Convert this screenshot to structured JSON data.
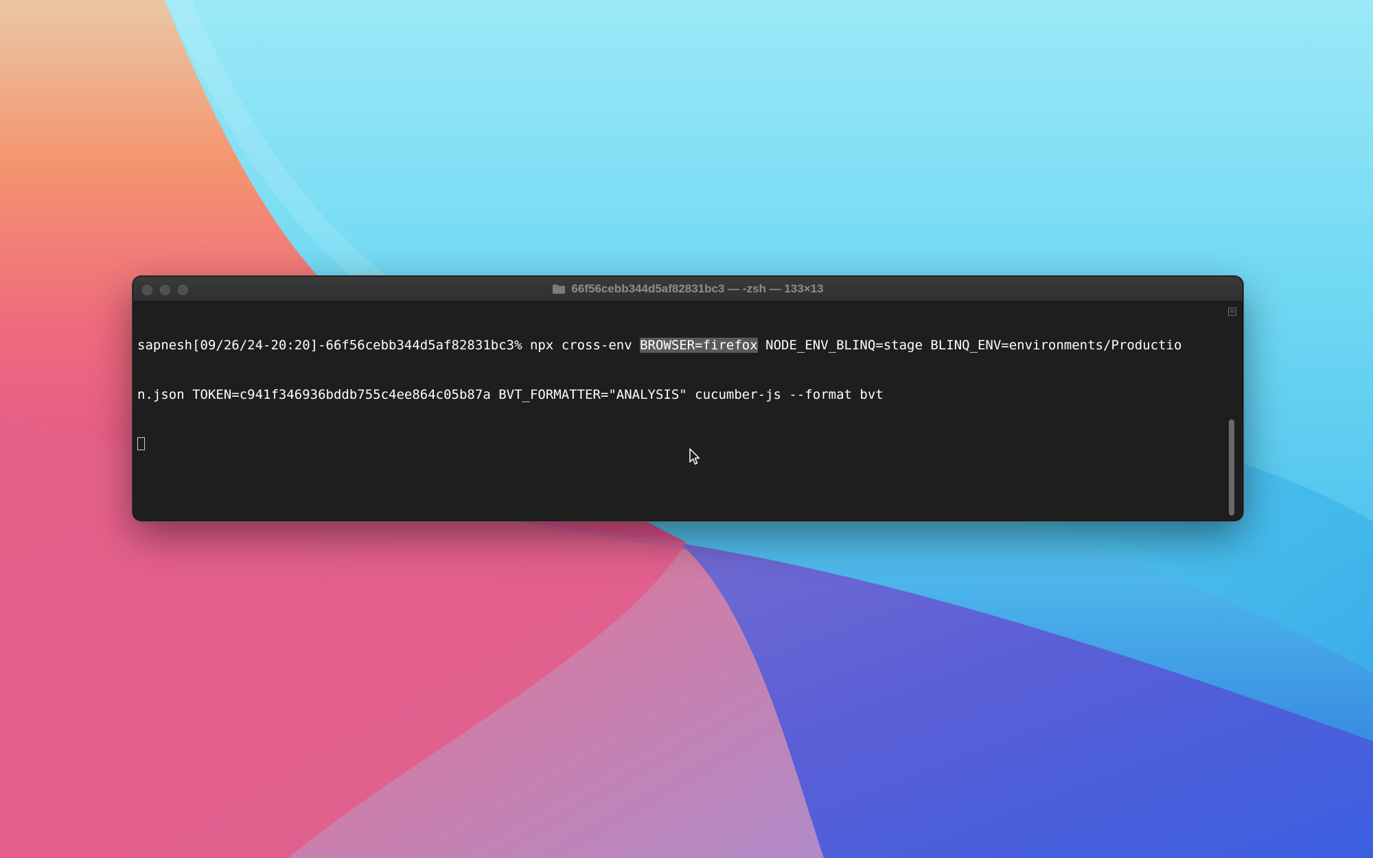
{
  "window": {
    "title": "66f56cebb344d5af82831bc3 — -zsh — 133×13"
  },
  "terminal": {
    "line1_prefix": "sapnesh[09/26/24-20:20]-66f56cebb344d5af82831bc3% npx cross-env ",
    "line1_selected": "BROWSER=firefox",
    "line1_suffix": " NODE_ENV_BLINQ=stage BLINQ_ENV=environments/Productio",
    "line2": "n.json TOKEN=c941f346936bddb755c4ee864c05b87a BVT_FORMATTER=\"ANALYSIS\" cucumber-js --format bvt"
  },
  "icons": {
    "title_icon": "folder-icon",
    "scroll_cap_icon": "scrollbar-menu-icon",
    "pointer": "mouse-pointer-icon"
  },
  "colors": {
    "terminal_bg": "#1e1e1e",
    "text": "#ffffff",
    "selection": "#5a5a5a"
  }
}
